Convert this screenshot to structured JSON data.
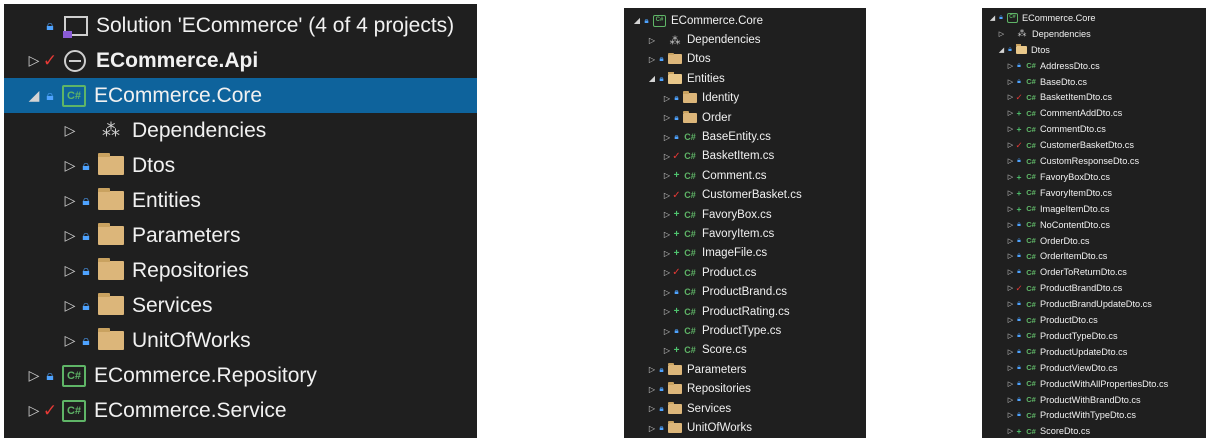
{
  "panels": [
    {
      "id": "p1",
      "rows": [
        {
          "indent": 0,
          "expander": "none",
          "badge": "lock",
          "icon": "solution",
          "label": "Solution 'ECommerce' (4 of 4 projects)"
        },
        {
          "indent": 0,
          "expander": "collapsed",
          "badge": "check",
          "icon": "web-project",
          "label": "ECommerce.Api",
          "bold": true
        },
        {
          "indent": 0,
          "expander": "expanded",
          "badge": "lock",
          "icon": "csharp-project",
          "label": "ECommerce.Core",
          "selected": true
        },
        {
          "indent": 1,
          "expander": "collapsed",
          "badge": "none",
          "icon": "dependencies",
          "label": "Dependencies"
        },
        {
          "indent": 1,
          "expander": "collapsed",
          "badge": "lock",
          "icon": "folder",
          "label": "Dtos"
        },
        {
          "indent": 1,
          "expander": "collapsed",
          "badge": "lock",
          "icon": "folder",
          "label": "Entities"
        },
        {
          "indent": 1,
          "expander": "collapsed",
          "badge": "lock",
          "icon": "folder",
          "label": "Parameters"
        },
        {
          "indent": 1,
          "expander": "collapsed",
          "badge": "lock",
          "icon": "folder",
          "label": "Repositories"
        },
        {
          "indent": 1,
          "expander": "collapsed",
          "badge": "lock",
          "icon": "folder",
          "label": "Services"
        },
        {
          "indent": 1,
          "expander": "collapsed",
          "badge": "lock",
          "icon": "folder",
          "label": "UnitOfWorks"
        },
        {
          "indent": 0,
          "expander": "collapsed",
          "badge": "lock",
          "icon": "csharp-project",
          "label": "ECommerce.Repository"
        },
        {
          "indent": 0,
          "expander": "collapsed",
          "badge": "check",
          "icon": "csharp-project",
          "label": "ECommerce.Service"
        }
      ]
    },
    {
      "id": "p2",
      "rows": [
        {
          "indent": 0,
          "expander": "expanded",
          "badge": "lock",
          "icon": "csharp-project",
          "label": "ECommerce.Core"
        },
        {
          "indent": 1,
          "expander": "collapsed",
          "badge": "none",
          "icon": "dependencies",
          "label": "Dependencies"
        },
        {
          "indent": 1,
          "expander": "collapsed",
          "badge": "lock",
          "icon": "folder",
          "label": "Dtos"
        },
        {
          "indent": 1,
          "expander": "expanded",
          "badge": "lock",
          "icon": "folder-open",
          "label": "Entities"
        },
        {
          "indent": 2,
          "expander": "collapsed",
          "badge": "lock",
          "icon": "folder",
          "label": "Identity"
        },
        {
          "indent": 2,
          "expander": "collapsed",
          "badge": "lock",
          "icon": "folder",
          "label": "Order"
        },
        {
          "indent": 2,
          "expander": "collapsed",
          "badge": "lock",
          "icon": "csharp-file",
          "label": "BaseEntity.cs"
        },
        {
          "indent": 2,
          "expander": "collapsed",
          "badge": "check",
          "icon": "csharp-file",
          "label": "BasketItem.cs"
        },
        {
          "indent": 2,
          "expander": "collapsed",
          "badge": "plus",
          "icon": "csharp-file",
          "label": "Comment.cs"
        },
        {
          "indent": 2,
          "expander": "collapsed",
          "badge": "check",
          "icon": "csharp-file",
          "label": "CustomerBasket.cs"
        },
        {
          "indent": 2,
          "expander": "collapsed",
          "badge": "plus",
          "icon": "csharp-file",
          "label": "FavoryBox.cs"
        },
        {
          "indent": 2,
          "expander": "collapsed",
          "badge": "plus",
          "icon": "csharp-file",
          "label": "FavoryItem.cs"
        },
        {
          "indent": 2,
          "expander": "collapsed",
          "badge": "plus",
          "icon": "csharp-file",
          "label": "ImageFile.cs"
        },
        {
          "indent": 2,
          "expander": "collapsed",
          "badge": "check",
          "icon": "csharp-file",
          "label": "Product.cs"
        },
        {
          "indent": 2,
          "expander": "collapsed",
          "badge": "lock",
          "icon": "csharp-file",
          "label": "ProductBrand.cs"
        },
        {
          "indent": 2,
          "expander": "collapsed",
          "badge": "plus",
          "icon": "csharp-file",
          "label": "ProductRating.cs"
        },
        {
          "indent": 2,
          "expander": "collapsed",
          "badge": "lock",
          "icon": "csharp-file",
          "label": "ProductType.cs"
        },
        {
          "indent": 2,
          "expander": "collapsed",
          "badge": "plus",
          "icon": "csharp-file",
          "label": "Score.cs"
        },
        {
          "indent": 1,
          "expander": "collapsed",
          "badge": "lock",
          "icon": "folder",
          "label": "Parameters"
        },
        {
          "indent": 1,
          "expander": "collapsed",
          "badge": "lock",
          "icon": "folder",
          "label": "Repositories"
        },
        {
          "indent": 1,
          "expander": "collapsed",
          "badge": "lock",
          "icon": "folder",
          "label": "Services"
        },
        {
          "indent": 1,
          "expander": "collapsed",
          "badge": "lock",
          "icon": "folder",
          "label": "UnitOfWorks"
        }
      ]
    },
    {
      "id": "p3",
      "rows": [
        {
          "indent": 0,
          "expander": "expanded",
          "badge": "lock",
          "icon": "csharp-project",
          "label": "ECommerce.Core"
        },
        {
          "indent": 1,
          "expander": "collapsed",
          "badge": "none",
          "icon": "dependencies",
          "label": "Dependencies"
        },
        {
          "indent": 1,
          "expander": "expanded",
          "badge": "lock",
          "icon": "folder-open",
          "label": "Dtos"
        },
        {
          "indent": 2,
          "expander": "collapsed",
          "badge": "lock",
          "icon": "csharp-file",
          "label": "AddressDto.cs"
        },
        {
          "indent": 2,
          "expander": "collapsed",
          "badge": "lock",
          "icon": "csharp-file",
          "label": "BaseDto.cs"
        },
        {
          "indent": 2,
          "expander": "collapsed",
          "badge": "check",
          "icon": "csharp-file",
          "label": "BasketItemDto.cs"
        },
        {
          "indent": 2,
          "expander": "collapsed",
          "badge": "plus",
          "icon": "csharp-file",
          "label": "CommentAddDto.cs"
        },
        {
          "indent": 2,
          "expander": "collapsed",
          "badge": "plus",
          "icon": "csharp-file",
          "label": "CommentDto.cs"
        },
        {
          "indent": 2,
          "expander": "collapsed",
          "badge": "check",
          "icon": "csharp-file",
          "label": "CustomerBasketDto.cs"
        },
        {
          "indent": 2,
          "expander": "collapsed",
          "badge": "lock",
          "icon": "csharp-file",
          "label": "CustomResponseDto.cs"
        },
        {
          "indent": 2,
          "expander": "collapsed",
          "badge": "plus",
          "icon": "csharp-file",
          "label": "FavoryBoxDto.cs"
        },
        {
          "indent": 2,
          "expander": "collapsed",
          "badge": "plus",
          "icon": "csharp-file",
          "label": "FavoryItemDto.cs"
        },
        {
          "indent": 2,
          "expander": "collapsed",
          "badge": "plus",
          "icon": "csharp-file",
          "label": "ImageItemDto.cs"
        },
        {
          "indent": 2,
          "expander": "collapsed",
          "badge": "lock",
          "icon": "csharp-file",
          "label": "NoContentDto.cs"
        },
        {
          "indent": 2,
          "expander": "collapsed",
          "badge": "lock",
          "icon": "csharp-file",
          "label": "OrderDto.cs"
        },
        {
          "indent": 2,
          "expander": "collapsed",
          "badge": "lock",
          "icon": "csharp-file",
          "label": "OrderItemDto.cs"
        },
        {
          "indent": 2,
          "expander": "collapsed",
          "badge": "lock",
          "icon": "csharp-file",
          "label": "OrderToReturnDto.cs"
        },
        {
          "indent": 2,
          "expander": "collapsed",
          "badge": "check",
          "icon": "csharp-file",
          "label": "ProductBrandDto.cs"
        },
        {
          "indent": 2,
          "expander": "collapsed",
          "badge": "lock",
          "icon": "csharp-file",
          "label": "ProductBrandUpdateDto.cs"
        },
        {
          "indent": 2,
          "expander": "collapsed",
          "badge": "lock",
          "icon": "csharp-file",
          "label": "ProductDto.cs"
        },
        {
          "indent": 2,
          "expander": "collapsed",
          "badge": "lock",
          "icon": "csharp-file",
          "label": "ProductTypeDto.cs"
        },
        {
          "indent": 2,
          "expander": "collapsed",
          "badge": "lock",
          "icon": "csharp-file",
          "label": "ProductUpdateDto.cs"
        },
        {
          "indent": 2,
          "expander": "collapsed",
          "badge": "lock",
          "icon": "csharp-file",
          "label": "ProductViewDto.cs"
        },
        {
          "indent": 2,
          "expander": "collapsed",
          "badge": "lock",
          "icon": "csharp-file",
          "label": "ProductWithAllPropertiesDto.cs"
        },
        {
          "indent": 2,
          "expander": "collapsed",
          "badge": "lock",
          "icon": "csharp-file",
          "label": "ProductWithBrandDto.cs"
        },
        {
          "indent": 2,
          "expander": "collapsed",
          "badge": "lock",
          "icon": "csharp-file",
          "label": "ProductWithTypeDto.cs"
        },
        {
          "indent": 2,
          "expander": "collapsed",
          "badge": "plus",
          "icon": "csharp-file",
          "label": "ScoreDto.cs"
        }
      ]
    }
  ],
  "icon_glyphs": {
    "csharp-project": "C#",
    "csharp-file": "C#",
    "dependencies": "⁂",
    "lock": "🔒︎",
    "check": "✓",
    "plus": "+",
    "expanded": "◢",
    "collapsed": "▷"
  },
  "colors": {
    "panel_background": "#1f1f1f",
    "selection": "#0e639c",
    "text": "#f1f1f1",
    "lock_badge": "#4ea3ff",
    "check_badge": "#e53935",
    "plus_badge": "#4ec36e",
    "folder": "#dcb67a",
    "csharp": "#5fb567"
  }
}
